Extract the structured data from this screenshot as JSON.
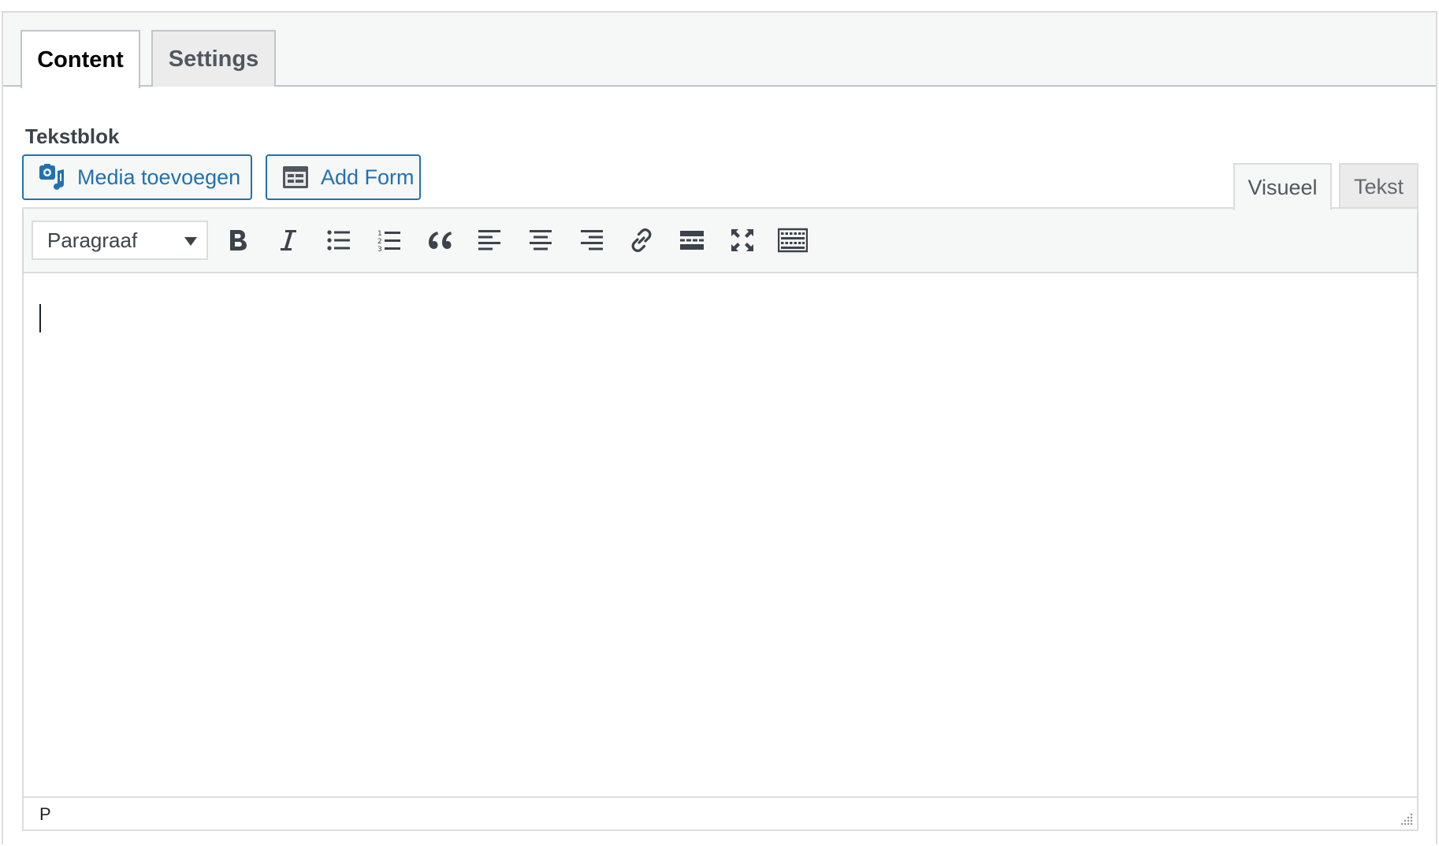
{
  "tabs": [
    {
      "label": "Content",
      "active": true
    },
    {
      "label": "Settings",
      "active": false
    }
  ],
  "field": {
    "label": "Tekstblok"
  },
  "media_buttons": {
    "media_label": "Media toevoegen",
    "media_icon": "media-add-icon",
    "form_label": "Add Form",
    "form_icon": "form-icon"
  },
  "editor_modes": {
    "visual_label": "Visueel",
    "text_label": "Tekst",
    "active": "Visueel"
  },
  "toolbar": {
    "format_value": "Paragraaf",
    "buttons": [
      "bold-icon",
      "italic-icon",
      "bullet-list-icon",
      "numbered-list-icon",
      "blockquote-icon",
      "align-left-icon",
      "align-center-icon",
      "align-right-icon",
      "link-icon",
      "read-more-icon",
      "fullscreen-icon",
      "toolbar-toggle-icon"
    ]
  },
  "statusbar": {
    "path": "P"
  },
  "colors": {
    "accent": "#2271b1",
    "icon": "#3c434a",
    "border": "#dcdcde",
    "toolbar_bg": "#f6f7f7"
  }
}
